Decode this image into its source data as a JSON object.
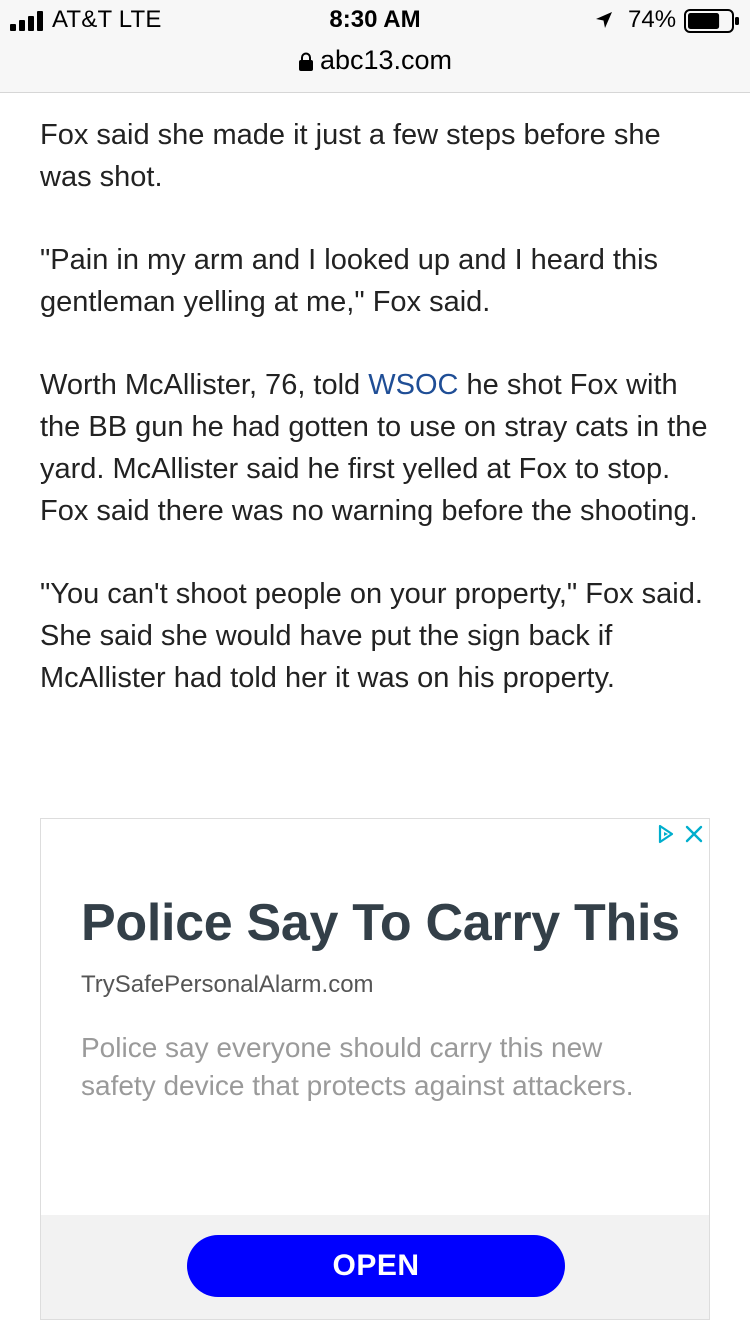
{
  "status_bar": {
    "carrier": "AT&T  LTE",
    "time": "8:30 AM",
    "battery_percent": "74%",
    "battery_level": 0.74,
    "signal_bars": 4
  },
  "browser": {
    "url": "abc13.com"
  },
  "article": {
    "p1": "Fox said she made it just a few steps before she was shot.",
    "p2": "\"Pain in my arm and I looked up and I heard this gentleman yelling at me,\" Fox said.",
    "p3_before": "Worth McAllister, 76, told ",
    "p3_link": "WSOC",
    "p3_after": " he shot Fox with the BB gun he had gotten to use on stray cats in the yard. McAllister said he first yelled at Fox to stop. Fox said there was no warning before the shooting.",
    "p4": "\"You can't shoot people on your property,\" Fox said. She said she would have put the sign back if McAllister had told her it was on his property."
  },
  "ad": {
    "title": "Police Say To Carry This",
    "domain": "TrySafePersonalAlarm.com",
    "description": "Police say everyone should carry this new safety device that protects against attackers.",
    "cta": "OPEN",
    "adchoices_icon": "adchoices-icon",
    "close_icon": "close-icon"
  },
  "colors": {
    "link": "#1f4e96",
    "cta_bg": "#0000ff",
    "ad_title": "#333f48",
    "adchoices": "#00aecd"
  }
}
